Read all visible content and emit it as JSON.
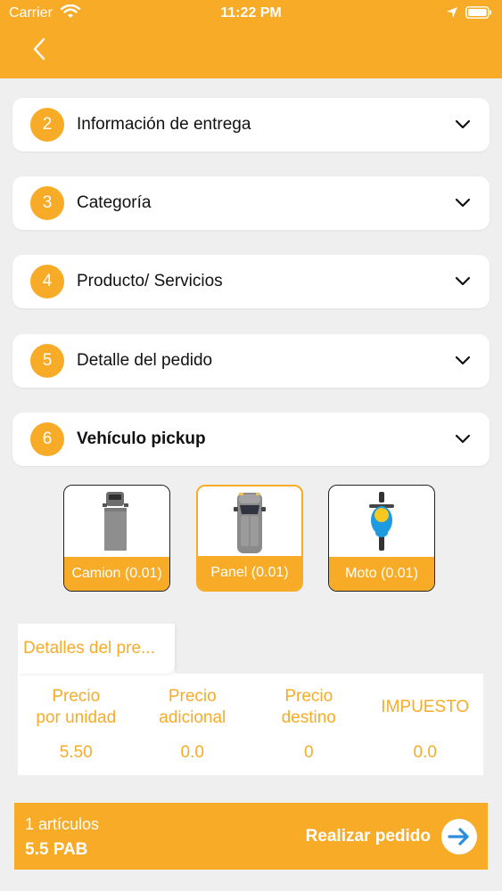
{
  "status_bar": {
    "carrier": "Carrier",
    "time": "11:22 PM"
  },
  "header": {
    "back_icon": "chevron-left-icon"
  },
  "sections": [
    {
      "step": "2",
      "title": "Información de entrega"
    },
    {
      "step": "3",
      "title": "Categoría"
    },
    {
      "step": "4",
      "title": "Producto/ Servicios"
    },
    {
      "step": "5",
      "title": "Detalle del pedido"
    },
    {
      "step": "6",
      "title": "Vehículo pickup"
    }
  ],
  "vehicles": [
    {
      "label": "Camion (0.01)",
      "icon": "truck-icon",
      "selected": false
    },
    {
      "label": "Panel (0.01)",
      "icon": "van-icon",
      "selected": true
    },
    {
      "label": "Moto (0.01)",
      "icon": "motorcycle-icon",
      "selected": false
    }
  ],
  "details": {
    "tab_label": "Detalles del pre...",
    "columns": [
      {
        "header_line1": "Precio",
        "header_line2": "por unidad",
        "value": "5.50"
      },
      {
        "header_line1": "Precio",
        "header_line2": "adicional",
        "value": "0.0"
      },
      {
        "header_line1": "Precio",
        "header_line2": "destino",
        "value": "0"
      },
      {
        "header_line1": "IMPUESTO",
        "header_line2": "",
        "value": "0.0"
      }
    ]
  },
  "order_bar": {
    "item_count": "1 artículos",
    "total": "5.5 PAB",
    "button_label": "Realizar pedido"
  },
  "colors": {
    "accent": "#f8ab27",
    "background": "#efefef",
    "arrow": "#2a8fd8"
  }
}
